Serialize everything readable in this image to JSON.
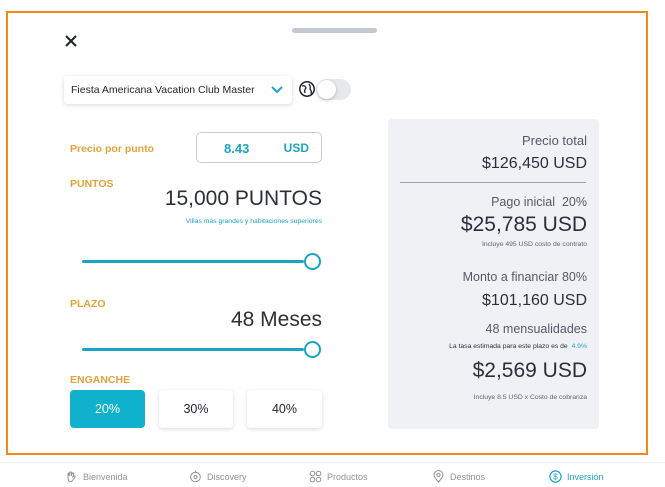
{
  "resort": {
    "selected": "Fiesta Americana Vacation Club Master"
  },
  "price_per_point": {
    "label": "Precio por punto",
    "value": "8.43",
    "currency": "USD"
  },
  "points": {
    "label": "PUNTOS",
    "value": "15,000 PUNTOS",
    "hint": "Villas más grandes y habitaciones superiores",
    "slider_level": 1.0
  },
  "term": {
    "label": "PLAZO",
    "value": "48 Meses",
    "slider_level": 1.0
  },
  "down_payment": {
    "label": "ENGANCHE",
    "options": [
      "20%",
      "30%",
      "40%"
    ],
    "selected_index": 0
  },
  "summary": {
    "total_label": "Precio total",
    "total_value": "$126,450 USD",
    "initial_label": "Pago inicial",
    "initial_pct": "20%",
    "initial_value": "$25,785 USD",
    "initial_note": "Incluye  495 USD costo de contrato",
    "finance_label": "Monto a financiar 80%",
    "finance_value": "$101,160 USD",
    "installments_label": "48 mensualidades",
    "rate_note": "La tasa estimada para este plazo es de",
    "rate_value": "4.9%",
    "monthly_value": "$2,569 USD",
    "monthly_note": "Incluye 8.5 USD x Costo de cobranza"
  },
  "nav": {
    "items": [
      {
        "label": "Bienvenida",
        "icon": "hand-wave-icon"
      },
      {
        "label": "Discovery",
        "icon": "compass-eye-icon"
      },
      {
        "label": "Productos",
        "icon": "grid-icon"
      },
      {
        "label": "Destinos",
        "icon": "map-pin-icon"
      },
      {
        "label": "Inversión",
        "icon": "dollar-circle-icon"
      }
    ],
    "active_index": 4
  },
  "colors": {
    "accent": "#1ba5c0",
    "orange": "#e3a23a",
    "frame": "#f28a1b",
    "panel": "#eff1f5"
  }
}
